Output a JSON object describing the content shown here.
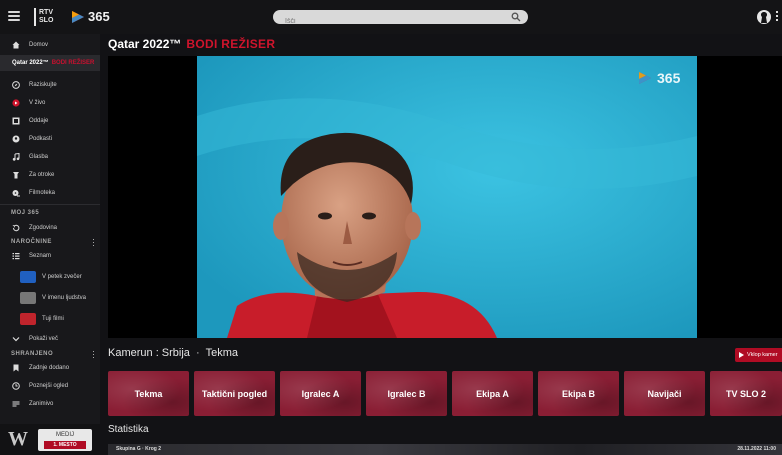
{
  "header": {
    "brand_rtv": "RTV\nSLO",
    "brand_rtv_top": "RTV",
    "brand_rtv_bottom": "SLO",
    "brand_365": "365",
    "search_placeholder": "Išči"
  },
  "sidebar": {
    "items": [
      {
        "label": "Domov",
        "icon": "home-icon"
      },
      {
        "label": "Qatar 2022™",
        "tag": "BODI REŽISER",
        "icon": "",
        "active": true
      },
      {
        "label": "Raziskujte",
        "icon": "compass-icon"
      },
      {
        "label": "V živo",
        "icon": "live-icon"
      },
      {
        "label": "Oddaje",
        "icon": "film-icon"
      },
      {
        "label": "Podkasti",
        "icon": "podcast-icon"
      },
      {
        "label": "Glasba",
        "icon": "music-icon"
      },
      {
        "label": "Za otroke",
        "icon": "kids-icon"
      },
      {
        "label": "Filmoteka",
        "icon": "film-reel-icon"
      }
    ],
    "section_moj": "MOJ 365",
    "history_label": "Zgodovina",
    "section_subscriptions": "NAROČNINE",
    "list_label": "Seznam",
    "subscriptions": [
      {
        "label": "V petek zvečer"
      },
      {
        "label": "V imenu ljudstva"
      },
      {
        "label": "Tuji filmi"
      }
    ],
    "show_more": "Pokaži več",
    "section_saved": "SHRANJENO",
    "saved": [
      {
        "label": "Zadnje dodano",
        "icon": "bookmark-icon"
      },
      {
        "label": "Poznejši ogled",
        "icon": "clock-icon"
      },
      {
        "label": "Zanimivo",
        "icon": "list-icon"
      }
    ],
    "promo": {
      "letter": "W",
      "line1": "MEDIJ",
      "line2": "1. MESTO"
    }
  },
  "main": {
    "title": "Qatar 2022™",
    "title_tag": "BODI REŽISER",
    "video_watermark": "365",
    "camera_label": "Kamerun : Srbija",
    "camera_mode": "Tekma",
    "watch_button": "Vklop kamer",
    "cameras": [
      "Tekma",
      "Taktični pogled",
      "Igralec A",
      "Igralec B",
      "Ekipa A",
      "Ekipa B",
      "Navijači",
      "TV SLO 2"
    ],
    "stats_title": "Statistika",
    "stats_left": "Skupina G · Krog 2",
    "stats_right": "28.11.2022 11:00"
  },
  "colors": {
    "accent": "#c8102e",
    "video_bg": "#2cb3d6",
    "camera_tile": "#8a1e34",
    "sidebar_bg": "#18181b"
  }
}
